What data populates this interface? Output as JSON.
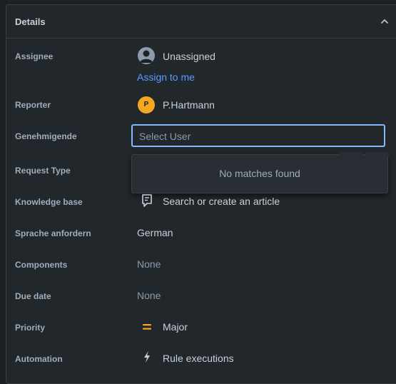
{
  "panel": {
    "title": "Details"
  },
  "fields": {
    "assignee": {
      "label": "Assignee",
      "value": "Unassigned",
      "action": "Assign to me"
    },
    "reporter": {
      "label": "Reporter",
      "value": "P.Hartmann",
      "initial": "P"
    },
    "approver": {
      "label": "Genehmigende",
      "placeholder": "Select User",
      "no_results": "No matches found"
    },
    "request_type": {
      "label": "Request Type"
    },
    "knowledge_base": {
      "label": "Knowledge base",
      "value": "Search or create an article"
    },
    "language": {
      "label": "Sprache anfordern",
      "value": "German"
    },
    "components": {
      "label": "Components",
      "value": "None"
    },
    "due_date": {
      "label": "Due date",
      "value": "None"
    },
    "priority": {
      "label": "Priority",
      "value": "Major",
      "color": "#f5a623"
    },
    "automation": {
      "label": "Automation",
      "value": "Rule executions"
    }
  },
  "icons": {
    "collapse": "chevron-up-icon",
    "unassigned": "person-icon",
    "knowledge": "article-icon",
    "priority": "equals-icon",
    "automation": "lightning-icon"
  }
}
